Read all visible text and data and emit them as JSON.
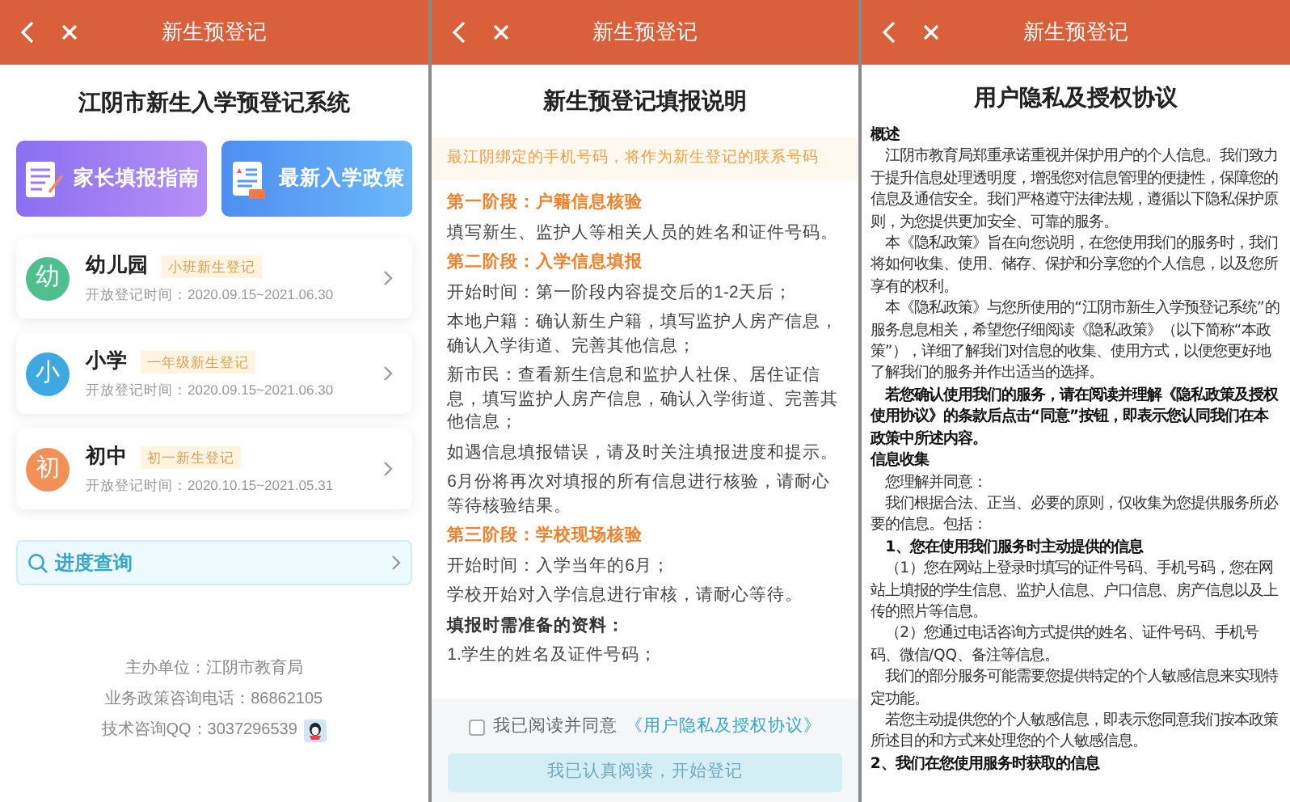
{
  "home": {
    "header": {
      "title": "新生预登记"
    },
    "title": "江阴市新生入学预登记系统",
    "banners": [
      {
        "kind": "guide",
        "label": "家长填报指南"
      },
      {
        "kind": "policy",
        "label": "最新入学政策"
      }
    ],
    "levels": [
      {
        "avatar": "幼",
        "color": "#4fc08d",
        "name": "幼儿园",
        "badge": "小班新生登记",
        "period": "开放登记时间：2020.09.15~2021.06.30"
      },
      {
        "avatar": "小",
        "color": "#3ea8e0",
        "name": "小学",
        "badge": "一年级新生登记",
        "period": "开放登记时间：2020.09.15~2021.06.30"
      },
      {
        "avatar": "初",
        "color": "#f39058",
        "name": "初中",
        "badge": "初一新生登记",
        "period": "开放登记时间：2020.10.15~2021.05.31"
      }
    ],
    "query": {
      "label": "进度查询"
    },
    "footer": [
      "主办单位：江阴市教育局",
      "业务政策咨询电话：86862105",
      "技术咨询QQ：3037296539"
    ]
  },
  "guide": {
    "header": {
      "title": "新生预登记"
    },
    "title": "新生预登记填报说明",
    "notice": "最江阴绑定的手机号码，将作为新生登记的联系号码",
    "blocks": [
      {
        "kind": "stage",
        "text": "第一阶段：户籍信息核验"
      },
      {
        "kind": "text",
        "text": "填写新生、监护人等相关人员的姓名和证件号码。"
      },
      {
        "kind": "stage",
        "text": "第二阶段：入学信息填报"
      },
      {
        "kind": "text",
        "text": "开始时间：第一阶段内容提交后的1-2天后；"
      },
      {
        "kind": "text",
        "text": "本地户籍：确认新生户籍，填写监护人房产信息，确认入学街道、完善其他信息；"
      },
      {
        "kind": "text",
        "text": "新市民：查看新生信息和监护人社保、居住证信息，填写监护人房产信息，确认入学街道、完善其他信息；"
      },
      {
        "kind": "text",
        "text": "如遇信息填报错误，请及时关注填报进度和提示。"
      },
      {
        "kind": "text",
        "text": "6月份将再次对填报的所有信息进行核验，请耐心等待核验结果。"
      },
      {
        "kind": "stage",
        "text": "第三阶段：学校现场核验"
      },
      {
        "kind": "text",
        "text": "开始时间：入学当年的6月；"
      },
      {
        "kind": "text",
        "text": "学校开始对入学信息进行审核，请耐心等待。"
      },
      {
        "kind": "label",
        "text": "填报时需准备的资料："
      },
      {
        "kind": "text",
        "text": "1.学生的姓名及证件号码；"
      }
    ],
    "agree": {
      "checked": false,
      "label": "我已阅读并同意",
      "link": "《用户隐私及授权协议》"
    },
    "submit": {
      "label": "我已认真阅读，开始登记",
      "disabled": true
    }
  },
  "agreement": {
    "header": {
      "title": "新生预登记"
    },
    "title": "用户隐私及授权协议",
    "blocks": [
      {
        "kind": "heading",
        "text": "概述"
      },
      {
        "kind": "para",
        "text": "江阴市教育局郑重承诺重视并保护用户的个人信息。我们致力于提升信息处理透明度，增强您对信息管理的便捷性，保障您的信息及通信安全。我们严格遵守法律法规，遵循以下隐私保护原则，为您提供更加安全、可靠的服务。"
      },
      {
        "kind": "para",
        "text": "本《隐私政策》旨在向您说明，在您使用我们的服务时，我们将如何收集、使用、储存、保护和分享您的个人信息，以及您所享有的权利。"
      },
      {
        "kind": "para",
        "text": "本《隐私政策》与您所使用的“江阴市新生入学预登记系统”的服务息息相关，希望您仔细阅读《隐私政策》（以下简称“本政策”），详细了解我们对信息的收集、使用方式，以便您更好地了解我们的服务并作出适当的选择。"
      },
      {
        "kind": "strong",
        "text": "若您确认使用我们的服务，请在阅读并理解《隐私政策及授权使用协议》的条款后点击“同意”按钮，即表示您认同我们在本政策中所述内容。"
      },
      {
        "kind": "heading",
        "text": "信息收集"
      },
      {
        "kind": "para",
        "text": "您理解并同意："
      },
      {
        "kind": "para",
        "text": "我们根据合法、正当、必要的原则，仅收集为您提供服务所必要的信息。包括："
      },
      {
        "kind": "strong",
        "text": "1、您在使用我们服务时主动提供的信息"
      },
      {
        "kind": "para",
        "text": "（1）您在网站上登录时填写的证件号码、手机号码，您在网站上填报的学生信息、监护人信息、户口信息、房产信息以及上传的照片等信息。"
      },
      {
        "kind": "para",
        "text": "（2）您通过电话咨询方式提供的姓名、证件号码、手机号码、微信/QQ、备注等信息。"
      },
      {
        "kind": "para",
        "text": "我们的部分服务可能需要您提供特定的个人敏感信息来实现特定功能。"
      },
      {
        "kind": "para",
        "text": "若您主动提供您的个人敏感信息，即表示您同意我们按本政策所述目的和方式来处理您的个人敏感信息。"
      },
      {
        "kind": "heading",
        "text": "2、我们在您使用服务时获取的信息"
      }
    ]
  }
}
